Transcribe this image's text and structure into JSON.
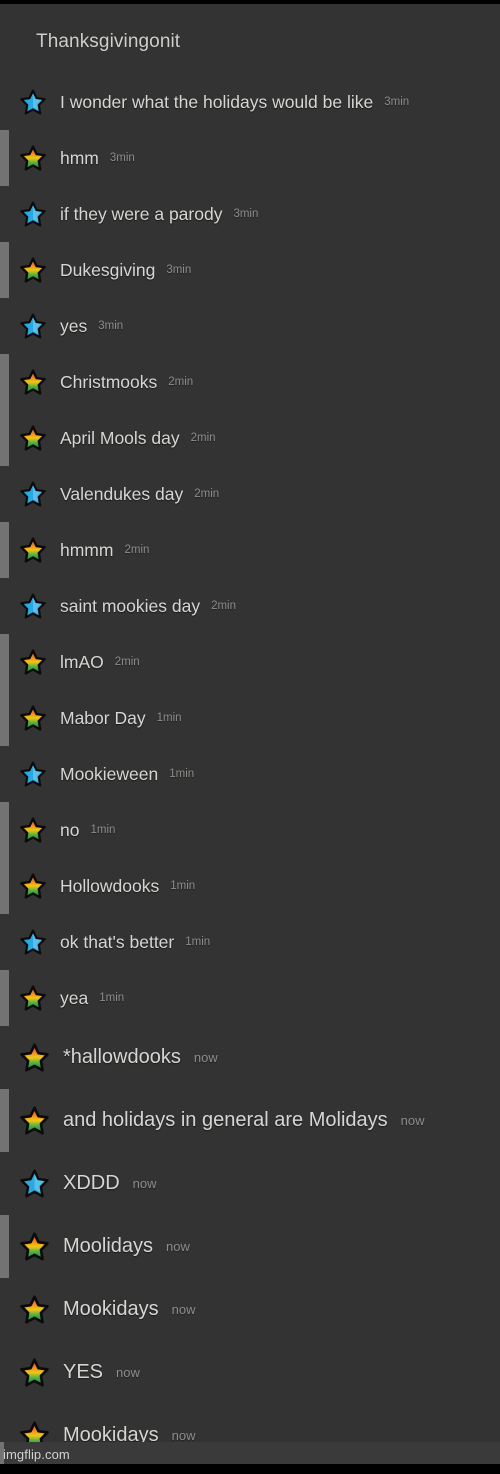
{
  "app": {
    "background_color": "#333333",
    "frame_color": "#000000",
    "text_color": "#d6d6d2",
    "timestamp_color": "#8d8d8a"
  },
  "thread": {
    "title": "Thanksgivingonit"
  },
  "avatars": {
    "blue_star": {
      "name": "blue-star-avatar",
      "fill": "#2aa8e0",
      "highlight": "#7fd4f5",
      "outline": "#0b0b0b"
    },
    "rainbow_star": {
      "name": "rainbow-star-avatar",
      "band_1": "#d9262a",
      "band_2": "#f07c1e",
      "band_3": "#f2c614",
      "band_4": "#3fae49",
      "band_5": "#2a7d3c",
      "outline": "#0b0b0b"
    }
  },
  "messages": [
    {
      "avatar": "blue",
      "text": "I wonder what the holidays would be like",
      "time": "3min",
      "edge": false,
      "size": "normal"
    },
    {
      "avatar": "rainbow",
      "text": "hmm",
      "time": "3min",
      "edge": true,
      "size": "normal"
    },
    {
      "avatar": "blue",
      "text": "if they were a parody",
      "time": "3min",
      "edge": false,
      "size": "normal"
    },
    {
      "avatar": "rainbow",
      "text": "Dukesgiving",
      "time": "3min",
      "edge": true,
      "size": "normal"
    },
    {
      "avatar": "blue",
      "text": "yes",
      "time": "3min",
      "edge": false,
      "size": "normal"
    },
    {
      "avatar": "rainbow",
      "text": "Christmooks",
      "time": "2min",
      "edge": true,
      "size": "normal"
    },
    {
      "avatar": "rainbow",
      "text": "April Mools day",
      "time": "2min",
      "edge": true,
      "size": "normal"
    },
    {
      "avatar": "blue",
      "text": "Valendukes day",
      "time": "2min",
      "edge": false,
      "size": "normal"
    },
    {
      "avatar": "rainbow",
      "text": "hmmm",
      "time": "2min",
      "edge": true,
      "size": "normal"
    },
    {
      "avatar": "blue",
      "text": "saint mookies day",
      "time": "2min",
      "edge": false,
      "size": "normal"
    },
    {
      "avatar": "rainbow",
      "text": "lmAO",
      "time": "2min",
      "edge": true,
      "size": "normal"
    },
    {
      "avatar": "rainbow",
      "text": "Mabor Day",
      "time": "1min",
      "edge": true,
      "size": "normal"
    },
    {
      "avatar": "blue",
      "text": "Mookieween",
      "time": "1min",
      "edge": false,
      "size": "normal"
    },
    {
      "avatar": "rainbow",
      "text": "no",
      "time": "1min",
      "edge": true,
      "size": "normal"
    },
    {
      "avatar": "rainbow",
      "text": "Hollowdooks",
      "time": "1min",
      "edge": true,
      "size": "normal"
    },
    {
      "avatar": "blue",
      "text": "ok that's better",
      "time": "1min",
      "edge": false,
      "size": "normal"
    },
    {
      "avatar": "rainbow",
      "text": "yea",
      "time": "1min",
      "edge": true,
      "size": "normal"
    },
    {
      "avatar": "rainbow",
      "text": "*hallowdooks",
      "time": "now",
      "edge": false,
      "size": "big"
    },
    {
      "avatar": "rainbow",
      "text": "and holidays in general are Molidays",
      "time": "now",
      "edge": true,
      "size": "big"
    },
    {
      "avatar": "blue",
      "text": "XDDD",
      "time": "now",
      "edge": false,
      "size": "big"
    },
    {
      "avatar": "rainbow",
      "text": "Moolidays",
      "time": "now",
      "edge": true,
      "size": "big"
    },
    {
      "avatar": "rainbow",
      "text": "Mookidays",
      "time": "now",
      "edge": false,
      "size": "big"
    },
    {
      "avatar": "rainbow",
      "text": "YES",
      "time": "now",
      "edge": false,
      "size": "big"
    },
    {
      "avatar": "rainbow",
      "text": "Mookidays",
      "time": "now",
      "edge": false,
      "size": "big"
    }
  ],
  "watermark": {
    "text": "imgflip.com"
  }
}
